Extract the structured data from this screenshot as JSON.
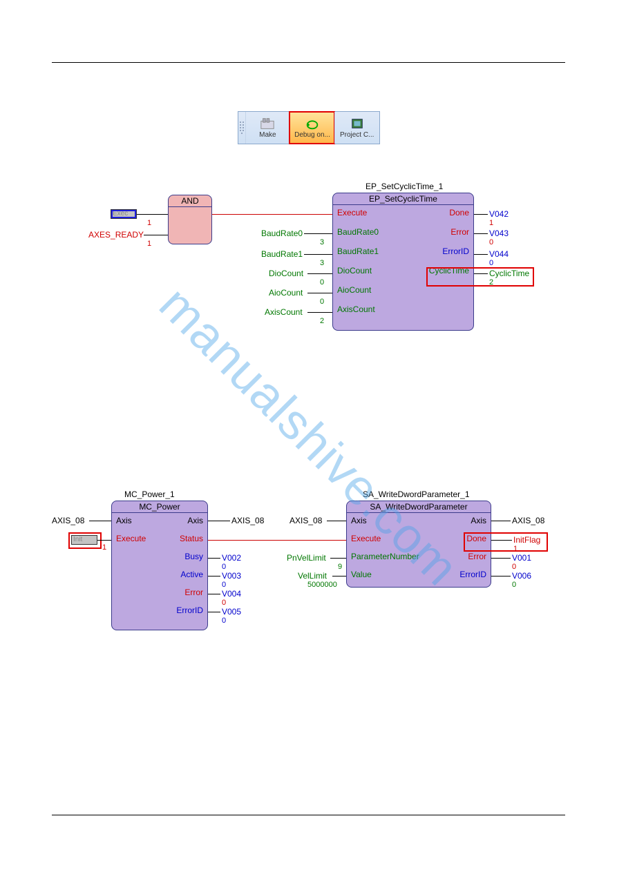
{
  "toolbar": {
    "make_label": "Make",
    "debug_label": "Debug on...",
    "projectc_label": "Project C..."
  },
  "diagram1": {
    "and": {
      "title": "AND"
    },
    "cyclic": {
      "instance": "EP_SetCyclicTime_1",
      "title": "EP_SetCyclicTime",
      "inputs": {
        "execute": "Execute",
        "baud0": "BaudRate0",
        "baud1": "BaudRate1",
        "diocount": "DioCount",
        "aiocount": "AioCount",
        "axiscount": "AxisCount"
      },
      "outputs": {
        "done": "Done",
        "error": "Error",
        "errorid": "ErrorID",
        "cyclictime": "CyclicTime"
      }
    },
    "ext": {
      "exec": "Exec",
      "exec_val": "1",
      "axes_ready": "AXES_READY",
      "axes_ready_val": "1",
      "baud0": "BaudRate0",
      "baud0_val": "3",
      "baud1": "BaudRate1",
      "baud1_val": "3",
      "diocount": "DioCount",
      "diocount_val": "0",
      "aiocount": "AioCount",
      "aiocount_val": "0",
      "axiscount": "AxisCount",
      "axiscount_val": "2",
      "v042": "V042",
      "v042_val": "1",
      "v043": "V043",
      "v043_val": "0",
      "v044": "V044",
      "v044_val": "0",
      "cyclictime": "CyclicTime",
      "cyclictime_val": "2"
    }
  },
  "diagram2": {
    "power": {
      "instance": "MC_Power_1",
      "title": "MC_Power",
      "inputs": {
        "axis": "Axis",
        "execute": "Execute"
      },
      "outputs": {
        "axis": "Axis",
        "status": "Status",
        "busy": "Busy",
        "active": "Active",
        "error": "Error",
        "errorid": "ErrorID"
      }
    },
    "write": {
      "instance": "SA_WriteDwordParameter_1",
      "title": "SA_WriteDwordParameter",
      "inputs": {
        "axis": "Axis",
        "execute": "Execute",
        "pn": "ParameterNumber",
        "value": "Value"
      },
      "outputs": {
        "axis": "Axis",
        "done": "Done",
        "error": "Error",
        "errorid": "ErrorID"
      }
    },
    "ext": {
      "axis08_l": "AXIS_08",
      "axis08_r": "AXIS_08",
      "axis08_l2": "AXIS_08",
      "axis08_r2": "AXIS_08",
      "init": "Init",
      "init_val": "1",
      "v002": "V002",
      "v002_val": "0",
      "v003": "V003",
      "v003_val": "0",
      "v004": "V004",
      "v004_val": "0",
      "v005": "V005",
      "v005_val": "0",
      "pnvel": "PnVelLimit",
      "pnvel_val": "9",
      "vellim": "VelLimit",
      "vellim_val": "5000000",
      "initflag": "InitFlag",
      "initflag_val": "1",
      "v001": "V001",
      "v001_val": "0",
      "v006": "V006",
      "v006_val": "0"
    }
  }
}
